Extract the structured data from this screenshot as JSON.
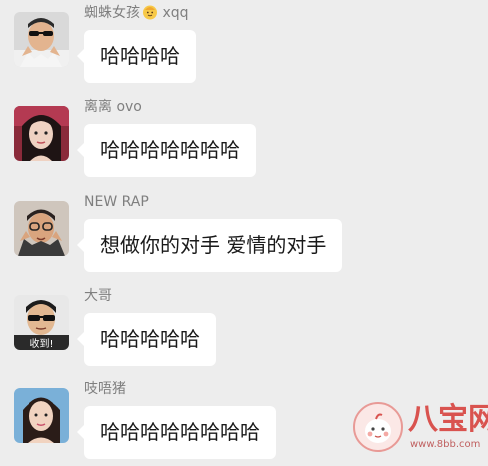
{
  "messages": [
    {
      "sender": "蜘蛛女孩",
      "sender_suffix": "xqq",
      "sender_emoji": "baby-face-emoji",
      "text": "哈哈哈哈"
    },
    {
      "sender": "离离 ovo",
      "text": "哈哈哈哈哈哈哈"
    },
    {
      "sender": "NEW RAP",
      "text": "想做你的对手 爱情的对手"
    },
    {
      "sender": "大哥",
      "avatar_caption": "收到!",
      "text": "哈哈哈哈哈"
    },
    {
      "sender": "吱唔猪",
      "text": "哈哈哈哈哈哈哈哈"
    }
  ],
  "watermark": {
    "name": "八宝网",
    "url": "www.8bb.com"
  },
  "colors": {
    "background": "#ededed",
    "bubble": "#ffffff",
    "sender_text": "#7f7f7f",
    "message_text": "#1a1a1a",
    "watermark_accent": "#d9534f"
  }
}
